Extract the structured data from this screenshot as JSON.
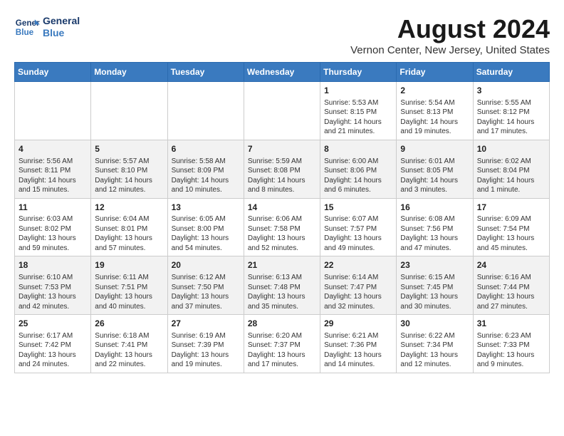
{
  "header": {
    "logo_line1": "General",
    "logo_line2": "Blue",
    "title": "August 2024",
    "subtitle": "Vernon Center, New Jersey, United States"
  },
  "days_of_week": [
    "Sunday",
    "Monday",
    "Tuesday",
    "Wednesday",
    "Thursday",
    "Friday",
    "Saturday"
  ],
  "weeks": [
    [
      {
        "day": "",
        "info": ""
      },
      {
        "day": "",
        "info": ""
      },
      {
        "day": "",
        "info": ""
      },
      {
        "day": "",
        "info": ""
      },
      {
        "day": "1",
        "info": "Sunrise: 5:53 AM\nSunset: 8:15 PM\nDaylight: 14 hours\nand 21 minutes."
      },
      {
        "day": "2",
        "info": "Sunrise: 5:54 AM\nSunset: 8:13 PM\nDaylight: 14 hours\nand 19 minutes."
      },
      {
        "day": "3",
        "info": "Sunrise: 5:55 AM\nSunset: 8:12 PM\nDaylight: 14 hours\nand 17 minutes."
      }
    ],
    [
      {
        "day": "4",
        "info": "Sunrise: 5:56 AM\nSunset: 8:11 PM\nDaylight: 14 hours\nand 15 minutes."
      },
      {
        "day": "5",
        "info": "Sunrise: 5:57 AM\nSunset: 8:10 PM\nDaylight: 14 hours\nand 12 minutes."
      },
      {
        "day": "6",
        "info": "Sunrise: 5:58 AM\nSunset: 8:09 PM\nDaylight: 14 hours\nand 10 minutes."
      },
      {
        "day": "7",
        "info": "Sunrise: 5:59 AM\nSunset: 8:08 PM\nDaylight: 14 hours\nand 8 minutes."
      },
      {
        "day": "8",
        "info": "Sunrise: 6:00 AM\nSunset: 8:06 PM\nDaylight: 14 hours\nand 6 minutes."
      },
      {
        "day": "9",
        "info": "Sunrise: 6:01 AM\nSunset: 8:05 PM\nDaylight: 14 hours\nand 3 minutes."
      },
      {
        "day": "10",
        "info": "Sunrise: 6:02 AM\nSunset: 8:04 PM\nDaylight: 14 hours\nand 1 minute."
      }
    ],
    [
      {
        "day": "11",
        "info": "Sunrise: 6:03 AM\nSunset: 8:02 PM\nDaylight: 13 hours\nand 59 minutes."
      },
      {
        "day": "12",
        "info": "Sunrise: 6:04 AM\nSunset: 8:01 PM\nDaylight: 13 hours\nand 57 minutes."
      },
      {
        "day": "13",
        "info": "Sunrise: 6:05 AM\nSunset: 8:00 PM\nDaylight: 13 hours\nand 54 minutes."
      },
      {
        "day": "14",
        "info": "Sunrise: 6:06 AM\nSunset: 7:58 PM\nDaylight: 13 hours\nand 52 minutes."
      },
      {
        "day": "15",
        "info": "Sunrise: 6:07 AM\nSunset: 7:57 PM\nDaylight: 13 hours\nand 49 minutes."
      },
      {
        "day": "16",
        "info": "Sunrise: 6:08 AM\nSunset: 7:56 PM\nDaylight: 13 hours\nand 47 minutes."
      },
      {
        "day": "17",
        "info": "Sunrise: 6:09 AM\nSunset: 7:54 PM\nDaylight: 13 hours\nand 45 minutes."
      }
    ],
    [
      {
        "day": "18",
        "info": "Sunrise: 6:10 AM\nSunset: 7:53 PM\nDaylight: 13 hours\nand 42 minutes."
      },
      {
        "day": "19",
        "info": "Sunrise: 6:11 AM\nSunset: 7:51 PM\nDaylight: 13 hours\nand 40 minutes."
      },
      {
        "day": "20",
        "info": "Sunrise: 6:12 AM\nSunset: 7:50 PM\nDaylight: 13 hours\nand 37 minutes."
      },
      {
        "day": "21",
        "info": "Sunrise: 6:13 AM\nSunset: 7:48 PM\nDaylight: 13 hours\nand 35 minutes."
      },
      {
        "day": "22",
        "info": "Sunrise: 6:14 AM\nSunset: 7:47 PM\nDaylight: 13 hours\nand 32 minutes."
      },
      {
        "day": "23",
        "info": "Sunrise: 6:15 AM\nSunset: 7:45 PM\nDaylight: 13 hours\nand 30 minutes."
      },
      {
        "day": "24",
        "info": "Sunrise: 6:16 AM\nSunset: 7:44 PM\nDaylight: 13 hours\nand 27 minutes."
      }
    ],
    [
      {
        "day": "25",
        "info": "Sunrise: 6:17 AM\nSunset: 7:42 PM\nDaylight: 13 hours\nand 24 minutes."
      },
      {
        "day": "26",
        "info": "Sunrise: 6:18 AM\nSunset: 7:41 PM\nDaylight: 13 hours\nand 22 minutes."
      },
      {
        "day": "27",
        "info": "Sunrise: 6:19 AM\nSunset: 7:39 PM\nDaylight: 13 hours\nand 19 minutes."
      },
      {
        "day": "28",
        "info": "Sunrise: 6:20 AM\nSunset: 7:37 PM\nDaylight: 13 hours\nand 17 minutes."
      },
      {
        "day": "29",
        "info": "Sunrise: 6:21 AM\nSunset: 7:36 PM\nDaylight: 13 hours\nand 14 minutes."
      },
      {
        "day": "30",
        "info": "Sunrise: 6:22 AM\nSunset: 7:34 PM\nDaylight: 13 hours\nand 12 minutes."
      },
      {
        "day": "31",
        "info": "Sunrise: 6:23 AM\nSunset: 7:33 PM\nDaylight: 13 hours\nand 9 minutes."
      }
    ]
  ]
}
